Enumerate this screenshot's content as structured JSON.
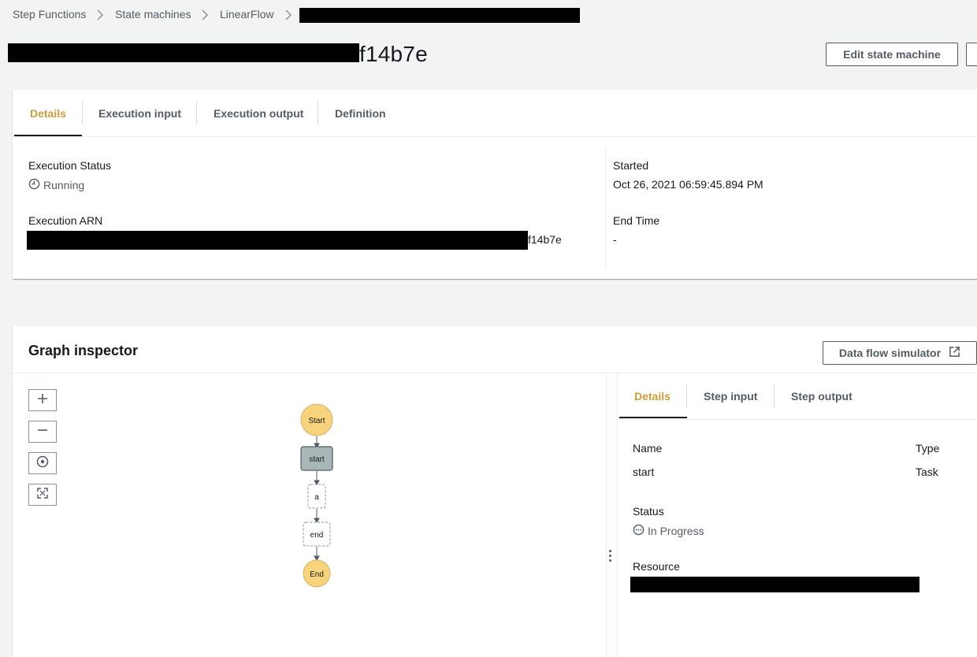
{
  "breadcrumb": {
    "items": [
      "Step Functions",
      "State machines",
      "LinearFlow"
    ]
  },
  "header": {
    "title_visible_suffix": "f14b7e",
    "edit_button": "Edit state machine"
  },
  "details_panel": {
    "tabs": [
      "Details",
      "Execution input",
      "Execution output",
      "Definition"
    ],
    "active_tab": "Details",
    "execution_status_label": "Execution Status",
    "execution_status_value": "Running",
    "execution_arn_label": "Execution ARN",
    "execution_arn_visible_suffix": "f14b7e",
    "started_label": "Started",
    "started_value": "Oct 26, 2021 06:59:45.894 PM",
    "end_time_label": "End Time",
    "end_time_value": "-"
  },
  "graph_inspector": {
    "title": "Graph inspector",
    "simulator_button": "Data flow simulator",
    "nodes": {
      "start_circle": "Start",
      "start_task": "start",
      "a_task": "a",
      "end_task": "end",
      "end_circle": "End"
    },
    "node_colors": {
      "terminal": "#f7d37c",
      "selected": "#aab7b8",
      "pending_border": "#879596"
    },
    "side_tabs": [
      "Details",
      "Step input",
      "Step output"
    ],
    "active_side_tab": "Details",
    "name_label": "Name",
    "name_value": "start",
    "type_label": "Type",
    "type_value": "Task",
    "status_label": "Status",
    "status_value": "In Progress",
    "resource_label": "Resource"
  },
  "colors": {
    "active_tab": "#d29c38",
    "background": "#f2f3f3"
  }
}
